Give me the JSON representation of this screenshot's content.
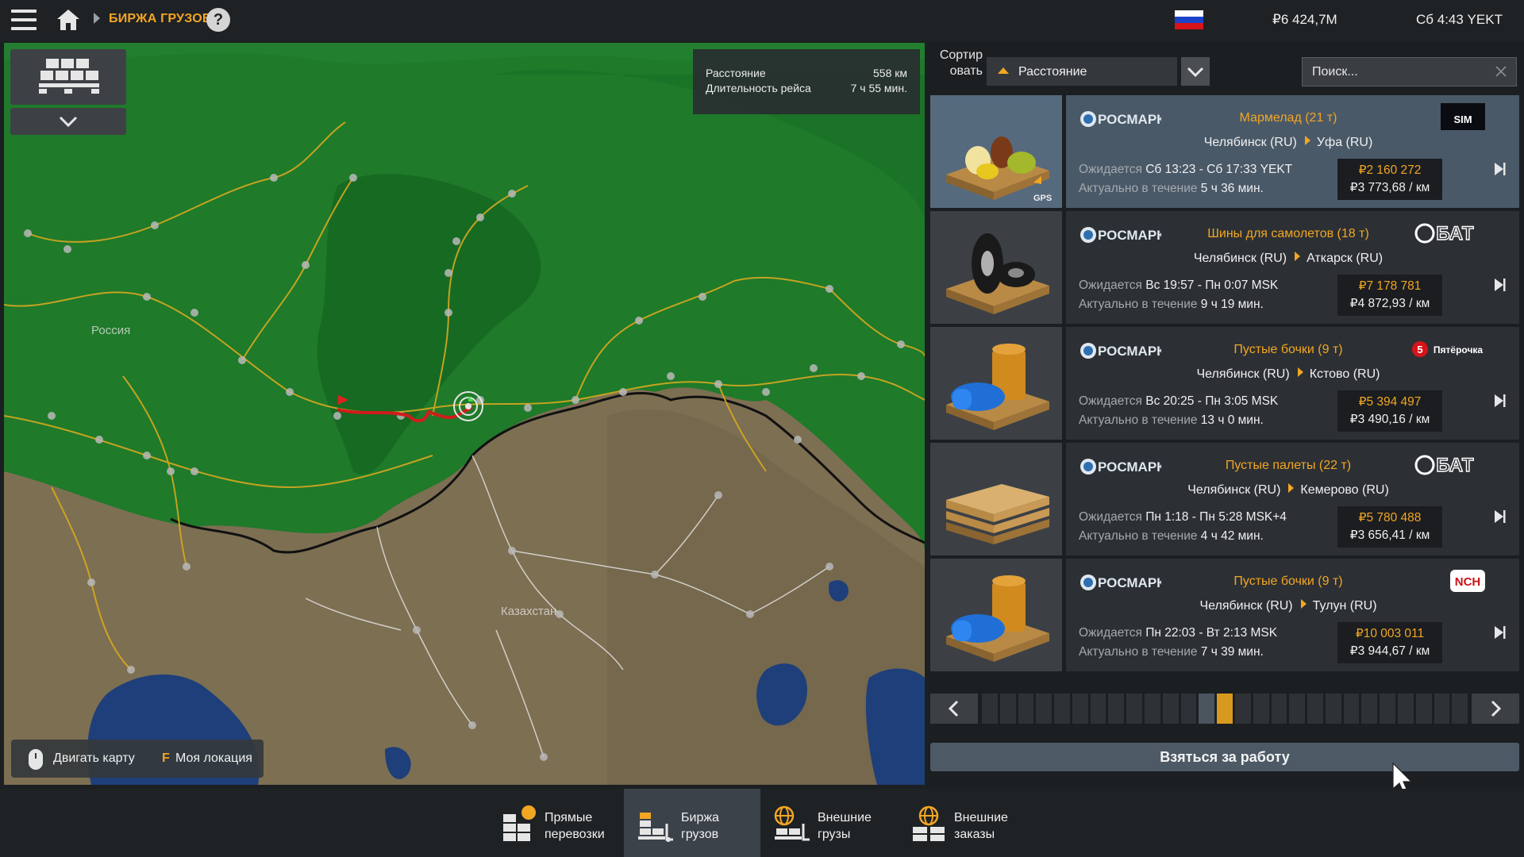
{
  "header": {
    "breadcrumb": "БИРЖА ГРУЗОВ",
    "help_icon_label": "?",
    "money": "₽6 424,7M",
    "time": "Сб 4:43 YEKT"
  },
  "map": {
    "route_info": {
      "distance_label": "Расстояние",
      "distance_value": "558 км",
      "duration_label": "Длительность рейса",
      "duration_value": "7 ч 55 мин."
    },
    "labels": {
      "russia": "Россия",
      "kazakhstan": "Казахстан"
    },
    "controls": {
      "move_map": "Двигать карту",
      "my_location_key": "F",
      "my_location": "Моя локация"
    }
  },
  "sort": {
    "label": "Сортировать",
    "label_line1": "Сортир",
    "label_line2": "овать",
    "selected": "Расстояние"
  },
  "search": {
    "placeholder": "Поиск..."
  },
  "jobs": [
    {
      "company": "РОСМАРК",
      "cargo": "Мармелад (21 т)",
      "from": "Челябинск (RU)",
      "to": "Уфа (RU)",
      "expected_label": "Ожидается",
      "expected": "Сб 13:23 - Сб 17:33 YEKT",
      "avail_label": "Актуально в течение",
      "avail": "5 ч 36 мин.",
      "price": "₽2 160 272",
      "price_per_km": "₽3 773,68 / км",
      "partner": "SIM",
      "thumb_badge": "GPS",
      "selected": true
    },
    {
      "company": "РОСМАРК",
      "cargo": "Шины для самолетов (18 т)",
      "from": "Челябинск (RU)",
      "to": "Аткарск (RU)",
      "expected_label": "Ожидается",
      "expected": "Вс 19:57 - Пн 0:07 MSK",
      "avail_label": "Актуально в течение",
      "avail": "9 ч 19 мин.",
      "price": "₽7 178 781",
      "price_per_km": "₽4 872,93 / км",
      "partner": "БАТ",
      "selected": false
    },
    {
      "company": "РОСМАРК",
      "cargo": "Пустые бочки (9 т)",
      "from": "Челябинск (RU)",
      "to": "Кстово (RU)",
      "expected_label": "Ожидается",
      "expected": "Вс 20:25 - Пн 3:05 MSK",
      "avail_label": "Актуально в течение",
      "avail": "13 ч 0 мин.",
      "price": "₽5 394 497",
      "price_per_km": "₽3 490,16 / км",
      "partner": "Пятёрочка",
      "selected": false
    },
    {
      "company": "РОСМАРК",
      "cargo": "Пустые палеты (22 т)",
      "from": "Челябинск (RU)",
      "to": "Кемерово (RU)",
      "expected_label": "Ожидается",
      "expected": "Пн 1:18 - Пн 5:28 MSK+4",
      "avail_label": "Актуально в течение",
      "avail": "4 ч 42 мин.",
      "price": "₽5 780 488",
      "price_per_km": "₽3 656,41 / км",
      "partner": "БАТ",
      "selected": false
    },
    {
      "company": "РОСМАРК",
      "cargo": "Пустые бочки (9 т)",
      "from": "Челябинск (RU)",
      "to": "Тулун (RU)",
      "expected_label": "Ожидается",
      "expected": "Пн 22:03 - Вт 2:13 MSK",
      "avail_label": "Актуально в течение",
      "avail": "7 ч 39 мин.",
      "price": "₽10 003 011",
      "price_per_km": "₽3 944,67 / км",
      "partner": "NCH",
      "selected": false
    }
  ],
  "pagination": {
    "total_pages": 27,
    "current_page": 14
  },
  "take_job_label": "Взяться за работу",
  "tabs": [
    {
      "line1": "Прямые",
      "line2": "перевозки",
      "active": false
    },
    {
      "line1": "Биржа",
      "line2": "грузов",
      "active": true
    },
    {
      "line1": "Внешние",
      "line2": "грузы",
      "active": false
    },
    {
      "line1": "Внешние",
      "line2": "заказы",
      "active": false
    }
  ],
  "colors": {
    "accent": "#f2a623",
    "selected_card": "#4a5968",
    "card": "#2c3034",
    "forest": "#1f7a2a",
    "steppe": "#7d6f52",
    "water": "#1e3f7a",
    "route": "#d01c1c"
  }
}
